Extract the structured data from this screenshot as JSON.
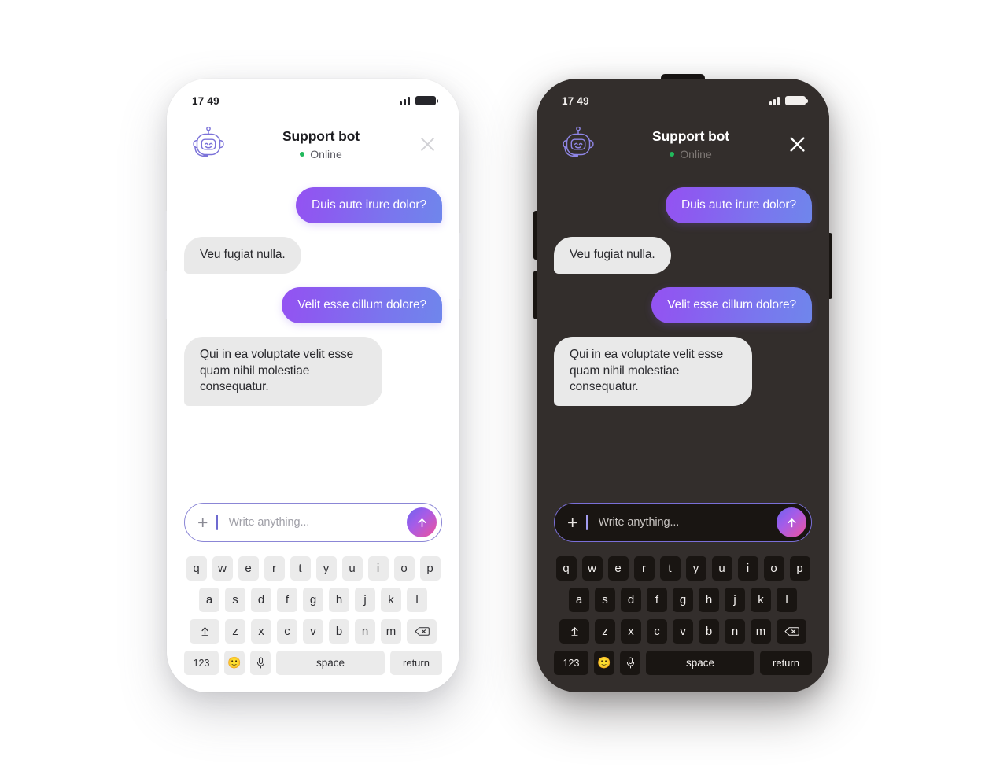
{
  "statusbar": {
    "time": "17 49",
    "signal_icon": "signal-bars-icon",
    "battery_icon": "battery-full-icon"
  },
  "header": {
    "avatar_icon": "robot-bot-avatar-icon",
    "bot_name": "Support bot",
    "status_text": "Online",
    "status_color": "#21b95c",
    "close_icon": "close-x-icon"
  },
  "messages": [
    {
      "side": "out",
      "text": "Duis aute irure dolor?"
    },
    {
      "side": "in",
      "text": "Veu fugiat nulla."
    },
    {
      "side": "out",
      "text": "Velit esse cillum dolore?"
    },
    {
      "side": "in",
      "text": "Qui in ea voluptate velit esse quam nihil molestiae consequatur."
    }
  ],
  "composer": {
    "plus_label": "+",
    "placeholder": "Write anything...",
    "send_icon": "arrow-up-send-icon"
  },
  "keyboard": {
    "row1": [
      "q",
      "w",
      "e",
      "r",
      "t",
      "y",
      "u",
      "i",
      "o",
      "p"
    ],
    "row2": [
      "a",
      "s",
      "d",
      "f",
      "g",
      "h",
      "j",
      "k",
      "l"
    ],
    "row3": [
      "z",
      "x",
      "c",
      "v",
      "b",
      "n",
      "m"
    ],
    "shift_icon": "shift-up-arrow-icon",
    "backspace_icon": "backspace-delete-icon",
    "numeric_label": "123",
    "emoji_label": "🙂",
    "mic_icon": "microphone-icon",
    "space_label": "space",
    "return_label": "return"
  },
  "theme": {
    "accent_purple": "#8b5cf0",
    "accent_blue": "#6f86ec",
    "send_pink": "#f0539a",
    "dark_body": "#332e2c",
    "dark_key": "#191512",
    "light_key": "#ebebeb",
    "bubble_in": "#e9e9e9"
  }
}
